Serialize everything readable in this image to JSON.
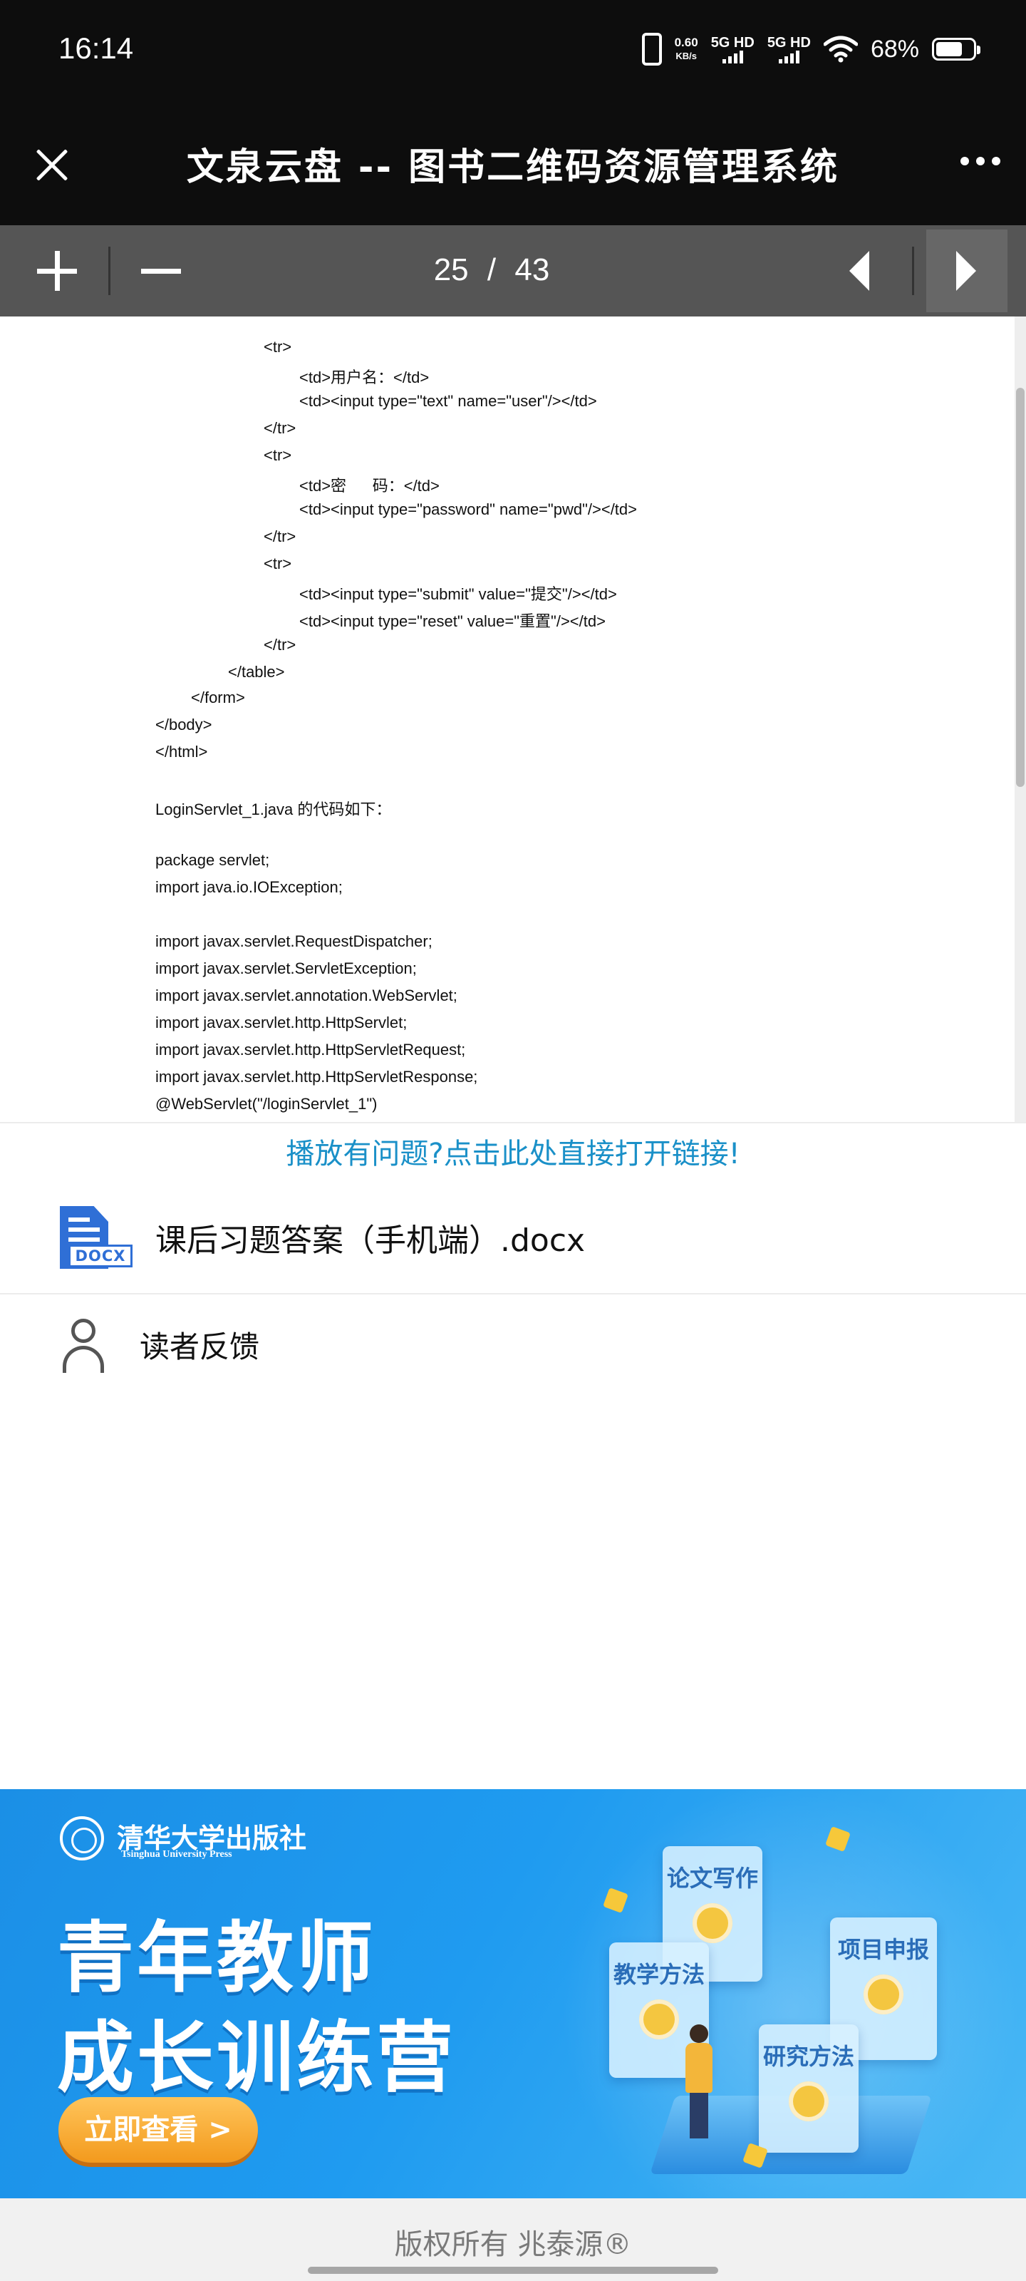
{
  "status_bar": {
    "time": "16:14",
    "speed_value": "0.60",
    "speed_unit": "KB/s",
    "network_1": "5G HD",
    "network_2": "5G HD",
    "battery": "68%",
    "icons": [
      "vibrate-icon",
      "signal-icon",
      "wifi-icon",
      "battery-icon"
    ]
  },
  "header": {
    "title": "文泉云盘 -- 图书二维码资源管理系统",
    "close_icon": "close-icon",
    "more_icon": "more-icon"
  },
  "toolbar": {
    "current_page": "25",
    "separator": "/",
    "total_pages": "43",
    "page_progress": 0.5814
  },
  "document": {
    "lines": [
      "<tr>",
      "<td>用户名：</td>",
      "<td><input type=\"text\" name=\"user\"/></td>",
      "</tr>",
      "<tr>",
      "<td>密      码：</td>",
      "<td><input type=\"password\" name=\"pwd\"/></td>",
      "</tr>",
      "<tr>",
      "<td><input type=\"submit\" value=\"提交\"/></td>",
      "<td><input type=\"reset\" value=\"重置\"/></td>",
      "</tr>",
      "</table>",
      "</form>",
      "</body>",
      "</html>",
      "LoginServlet_1.java 的代码如下：",
      "package servlet;",
      "import java.io.IOException;",
      "import javax.servlet.RequestDispatcher;",
      "import javax.servlet.ServletException;",
      "import javax.servlet.annotation.WebServlet;",
      "import javax.servlet.http.HttpServlet;",
      "import javax.servlet.http.HttpServletRequest;",
      "import javax.servlet.http.HttpServletResponse;",
      "@WebServlet(\"/loginServlet_1\")"
    ]
  },
  "play_link": "播放有问题?点击此处直接打开链接!",
  "attachment": {
    "icon": "docx-file-icon",
    "icon_tag": "DOCX",
    "name": "课后习题答案（手机端）.docx"
  },
  "feedback": {
    "icon": "user-icon",
    "label": "读者反馈"
  },
  "banner": {
    "publisher_cn": "清华大学出版社",
    "publisher_en": "Tsinghua University Press",
    "headline_line1": "青年教师",
    "headline_line2": "成长训练营",
    "cta": "立即查看 >",
    "cards": [
      "论文写作",
      "教学方法",
      "项目申报",
      "研究方法"
    ]
  },
  "footer": {
    "copyright": "版权所有 兆泰源®"
  },
  "colors": {
    "header_bg": "#0d0d0d",
    "toolbar_bg": "#555555",
    "link_blue": "#1a90c8",
    "banner_blue": "#1f9bf0",
    "cta_orange": "#f39a1d",
    "docx_blue": "#2f6fd6",
    "footer_bg": "#f1f1f1"
  }
}
